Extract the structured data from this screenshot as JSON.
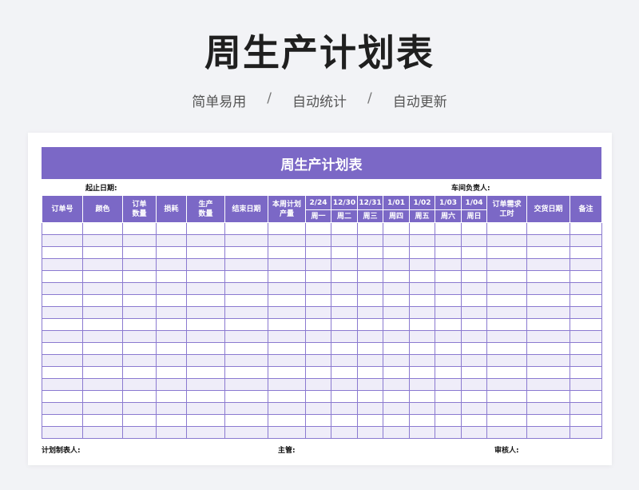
{
  "page": {
    "title": "周生产计划表",
    "features": [
      "简单易用",
      "自动统计",
      "自动更新"
    ],
    "separator": "/"
  },
  "sheet": {
    "title": "周生产计划表",
    "start_end_date_label": "起止日期:",
    "workshop_lead_label": "车间负责人:",
    "columns_before": [
      "订单号",
      "颜色",
      "订单\n数量",
      "损耗",
      "生产\n数量",
      "结束日期",
      "本周计划\n产量"
    ],
    "days": [
      {
        "date": "2/24",
        "weekday": "周一"
      },
      {
        "date": "12/30",
        "weekday": "周二"
      },
      {
        "date": "12/31",
        "weekday": "周三"
      },
      {
        "date": "1/01",
        "weekday": "周四"
      },
      {
        "date": "1/02",
        "weekday": "周五"
      },
      {
        "date": "1/03",
        "weekday": "周六"
      },
      {
        "date": "1/04",
        "weekday": "周日"
      }
    ],
    "columns_after": [
      "订单需求\n工时",
      "交货日期",
      "备注"
    ],
    "empty_row_count": 18,
    "footer": {
      "planner_label": "计划制表人:",
      "manager_label": "主管:",
      "reviewer_label": "审核人:"
    }
  },
  "colors": {
    "accent": "#7b68c6",
    "row_alt": "#efedf9",
    "background": "#f2f3f6"
  }
}
